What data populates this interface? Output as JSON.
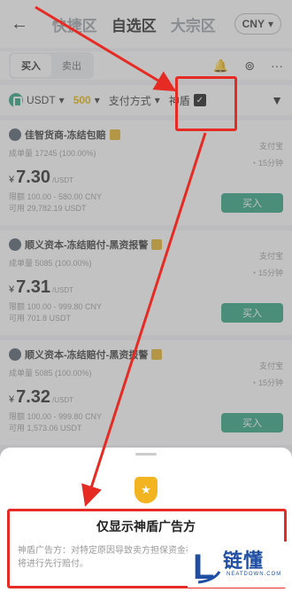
{
  "header": {
    "back_icon": "back-arrow-icon",
    "tabs": [
      "快捷区",
      "自选区",
      "大宗区"
    ],
    "active_tab": 1,
    "currency": "CNY"
  },
  "subbar": {
    "buy_tab": "买入",
    "sell_tab": "卖出",
    "icons": [
      "bell-icon",
      "order-icon",
      "more-icon"
    ]
  },
  "filters": {
    "coin": "USDT",
    "amount": "500",
    "payment": "支付方式",
    "shield_label": "神盾",
    "shield_checked": true
  },
  "listings": [
    {
      "merchant": "佳智货商-冻结包赔",
      "stats": "成单量 17245 (100.00%)",
      "currency_symbol": "¥",
      "price": "7.30",
      "price_unit": "/USDT",
      "limit": "限额 100.00 - 580.00 CNY",
      "available": "可用 29,782.19 USDT",
      "payment": "支付宝",
      "time": "15分钟",
      "button": "买入"
    },
    {
      "merchant": "顺义资本-冻结赔付-黑资报警",
      "stats": "成单量 5085 (100.00%)",
      "currency_symbol": "¥",
      "price": "7.31",
      "price_unit": "/USDT",
      "limit": "限额 100.00 - 999.80 CNY",
      "available": "可用 701.8 USDT",
      "payment": "支付宝",
      "time": "15分钟",
      "button": "买入"
    },
    {
      "merchant": "顺义资本-冻结赔付-黑资报警",
      "stats": "成单量 5085 (100.00%)",
      "currency_symbol": "¥",
      "price": "7.32",
      "price_unit": "/USDT",
      "limit": "限额 100.00 - 999.80 CNY",
      "available": "可用 1,573.06 USDT",
      "payment": "支付宝",
      "time": "15分钟",
      "button": "买入"
    }
  ],
  "sheet": {
    "icon": "shield-star-icon",
    "title": "仅显示神盾广告方",
    "description": "神盾广告方：对特定原因导致卖方担保资金被冻结的情况，我们将进行先行赔付。"
  },
  "watermark": {
    "logo_text": "L",
    "name": "链懂",
    "domain": "NEATDOWN.COM"
  },
  "colors": {
    "accent_green": "#26a17b",
    "annotation_red": "#e52b23",
    "shield_gold": "#f3b421",
    "watermark_blue": "#1f4ea3"
  }
}
